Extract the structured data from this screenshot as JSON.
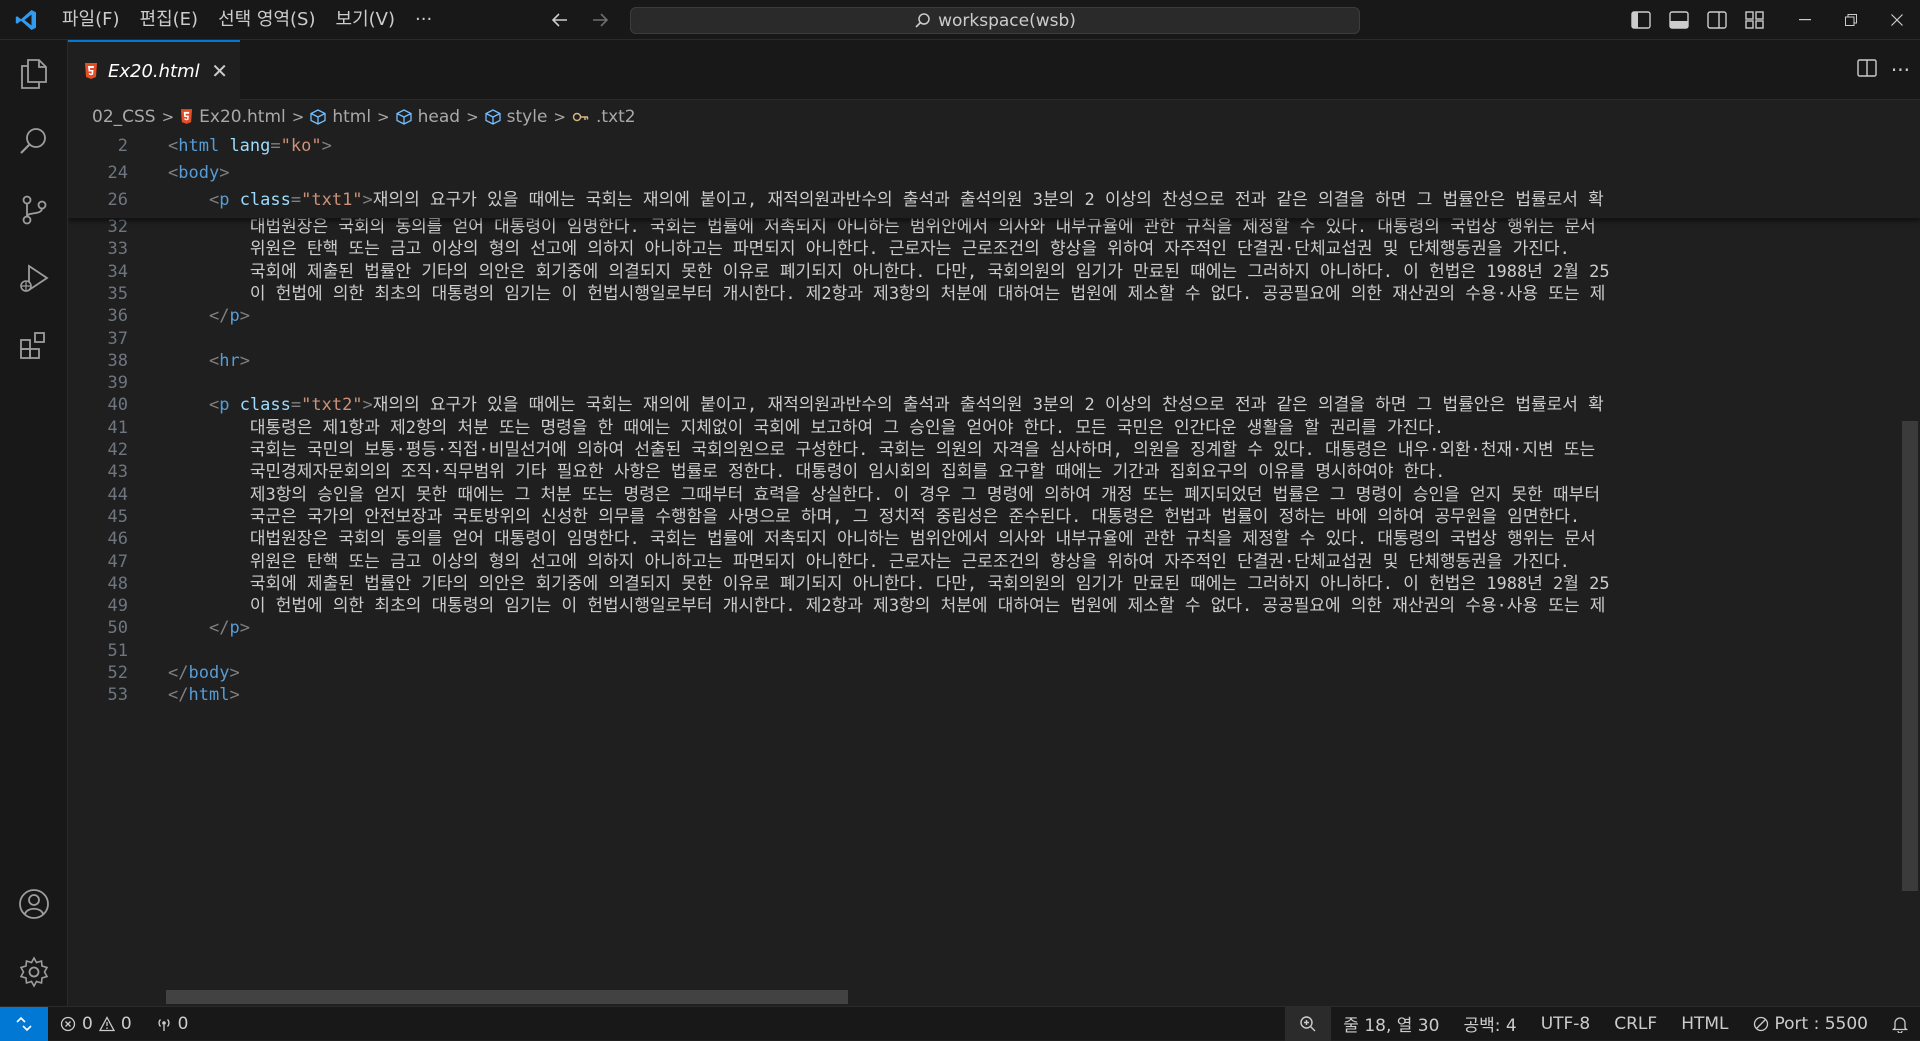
{
  "menu": [
    "파일(F)",
    "편집(E)",
    "선택 영역(S)",
    "보기(V)",
    "···"
  ],
  "search": {
    "text": "workspace(wsb)"
  },
  "tab": {
    "label": "Ex20.html",
    "close": "✕"
  },
  "breadcrumbs": [
    "02_CSS",
    "Ex20.html",
    "html",
    "head",
    "style",
    ".txt2"
  ],
  "editor": {
    "sticky": [
      {
        "n": "2",
        "parts": [
          [
            "tag",
            "<"
          ],
          [
            "tname",
            "html "
          ],
          [
            "attr",
            "lang"
          ],
          [
            "tag",
            "="
          ],
          [
            "str",
            "\"ko\""
          ],
          [
            "tag",
            ">"
          ]
        ]
      },
      {
        "n": "24",
        "parts": [
          [
            "tag",
            "<"
          ],
          [
            "tname",
            "body"
          ],
          [
            "tag",
            ">"
          ]
        ]
      },
      {
        "n": "26",
        "parts": [
          [
            "plain",
            "    "
          ],
          [
            "tag",
            "<"
          ],
          [
            "tname",
            "p "
          ],
          [
            "attr",
            "class"
          ],
          [
            "tag",
            "="
          ],
          [
            "str",
            "\"txt1\""
          ],
          [
            "tag",
            ">"
          ],
          [
            "plain",
            "재의의 요구가 있을 때에는 국회는 재의에 붙이고, 재적의원과반수의 출석과 출석의원 3분의 2 이상의 찬성으로 전과 같은 의결을 하면 그 법률안은 법률로서 확"
          ]
        ]
      }
    ],
    "lines": [
      {
        "n": "32",
        "parts": [
          [
            "plain",
            "        대법원장은 국회의 동의를 얻어 대통령이 임명한다. 국회는 법률에 저촉되지 아니하는 범위안에서 의사와 내부규율에 관한 규칙을 제정할 수 있다. 대통령의 국법상 행위는 문서"
          ]
        ]
      },
      {
        "n": "33",
        "parts": [
          [
            "plain",
            "        위원은 탄핵 또는 금고 이상의 형의 선고에 의하지 아니하고는 파면되지 아니한다. 근로자는 근로조건의 향상을 위하여 자주적인 단결권·단체교섭권 및 단체행동권을 가진다. "
          ]
        ]
      },
      {
        "n": "34",
        "parts": [
          [
            "plain",
            "        국회에 제출된 법률안 기타의 의안은 회기중에 의결되지 못한 이유로 폐기되지 아니한다. 다만, 국회의원의 임기가 만료된 때에는 그러하지 아니하다. 이 헌법은 1988년 2월 25"
          ]
        ]
      },
      {
        "n": "35",
        "parts": [
          [
            "plain",
            "        이 헌법에 의한 최초의 대통령의 임기는 이 헌법시행일로부터 개시한다. 제2항과 제3항의 처분에 대하여는 법원에 제소할 수 없다. 공공필요에 의한 재산권의 수용·사용 또는 제"
          ]
        ]
      },
      {
        "n": "36",
        "parts": [
          [
            "plain",
            "    "
          ],
          [
            "tag",
            "</"
          ],
          [
            "tname",
            "p"
          ],
          [
            "tag",
            ">"
          ]
        ]
      },
      {
        "n": "37",
        "parts": []
      },
      {
        "n": "38",
        "parts": [
          [
            "plain",
            "    "
          ],
          [
            "tag",
            "<"
          ],
          [
            "tname",
            "hr"
          ],
          [
            "tag",
            ">"
          ]
        ]
      },
      {
        "n": "39",
        "parts": []
      },
      {
        "n": "40",
        "parts": [
          [
            "plain",
            "    "
          ],
          [
            "tag",
            "<"
          ],
          [
            "tname",
            "p "
          ],
          [
            "attr",
            "class"
          ],
          [
            "tag",
            "="
          ],
          [
            "str",
            "\"txt2\""
          ],
          [
            "tag",
            ">"
          ],
          [
            "plain",
            "재의의 요구가 있을 때에는 국회는 재의에 붙이고, 재적의원과반수의 출석과 출석의원 3분의 2 이상의 찬성으로 전과 같은 의결을 하면 그 법률안은 법률로서 확"
          ]
        ]
      },
      {
        "n": "41",
        "parts": [
          [
            "plain",
            "        대통령은 제1항과 제2항의 처분 또는 명령을 한 때에는 지체없이 국회에 보고하여 그 승인을 얻어야 한다. 모든 국민은 인간다운 생활을 할 권리를 가진다."
          ]
        ]
      },
      {
        "n": "42",
        "parts": [
          [
            "plain",
            "        국회는 국민의 보통·평등·직접·비밀선거에 의하여 선출된 국회의원으로 구성한다. 국회는 의원의 자격을 심사하며, 의원을 징계할 수 있다. 대통령은 내우·외환·천재·지변 또는"
          ]
        ]
      },
      {
        "n": "43",
        "parts": [
          [
            "plain",
            "        국민경제자문회의의 조직·직무범위 기타 필요한 사항은 법률로 정한다. 대통령이 임시회의 집회를 요구할 때에는 기간과 집회요구의 이유를 명시하여야 한다."
          ]
        ]
      },
      {
        "n": "44",
        "parts": [
          [
            "plain",
            "        제3항의 승인을 얻지 못한 때에는 그 처분 또는 명령은 그때부터 효력을 상실한다. 이 경우 그 명령에 의하여 개정 또는 폐지되었던 법률은 그 명령이 승인을 얻지 못한 때부터"
          ]
        ]
      },
      {
        "n": "45",
        "parts": [
          [
            "plain",
            "        국군은 국가의 안전보장과 국토방위의 신성한 의무를 수행함을 사명으로 하며, 그 정치적 중립성은 준수된다. 대통령은 헌법과 법률이 정하는 바에 의하여 공무원을 임면한다."
          ]
        ]
      },
      {
        "n": "46",
        "parts": [
          [
            "plain",
            "        대법원장은 국회의 동의를 얻어 대통령이 임명한다. 국회는 법률에 저촉되지 아니하는 범위안에서 의사와 내부규율에 관한 규칙을 제정할 수 있다. 대통령의 국법상 행위는 문서"
          ]
        ]
      },
      {
        "n": "47",
        "parts": [
          [
            "plain",
            "        위원은 탄핵 또는 금고 이상의 형의 선고에 의하지 아니하고는 파면되지 아니한다. 근로자는 근로조건의 향상을 위하여 자주적인 단결권·단체교섭권 및 단체행동권을 가진다. "
          ]
        ]
      },
      {
        "n": "48",
        "parts": [
          [
            "plain",
            "        국회에 제출된 법률안 기타의 의안은 회기중에 의결되지 못한 이유로 폐기되지 아니한다. 다만, 국회의원의 임기가 만료된 때에는 그러하지 아니하다. 이 헌법은 1988년 2월 25"
          ]
        ]
      },
      {
        "n": "49",
        "parts": [
          [
            "plain",
            "        이 헌법에 의한 최초의 대통령의 임기는 이 헌법시행일로부터 개시한다. 제2항과 제3항의 처분에 대하여는 법원에 제소할 수 없다. 공공필요에 의한 재산권의 수용·사용 또는 제"
          ]
        ]
      },
      {
        "n": "50",
        "parts": [
          [
            "plain",
            "    "
          ],
          [
            "tag",
            "</"
          ],
          [
            "tname",
            "p"
          ],
          [
            "tag",
            ">"
          ]
        ]
      },
      {
        "n": "51",
        "parts": []
      },
      {
        "n": "52",
        "parts": [
          [
            "tag",
            "</"
          ],
          [
            "tname",
            "body"
          ],
          [
            "tag",
            ">"
          ]
        ]
      },
      {
        "n": "53",
        "parts": [
          [
            "tag",
            "</"
          ],
          [
            "tname",
            "html"
          ],
          [
            "tag",
            ">"
          ]
        ]
      }
    ]
  },
  "status": {
    "errors": "0",
    "warnings": "0",
    "ports": "0",
    "position": "줄 18, 열 30",
    "spaces": "공백: 4",
    "encoding": "UTF-8",
    "eol": "CRLF",
    "language": "HTML",
    "port": "Port : 5500"
  },
  "colors": {
    "accent": "#0078d4",
    "html_icon": "#e44d26",
    "symbol": "#75beff",
    "style_icon": "#d7ba7d"
  }
}
